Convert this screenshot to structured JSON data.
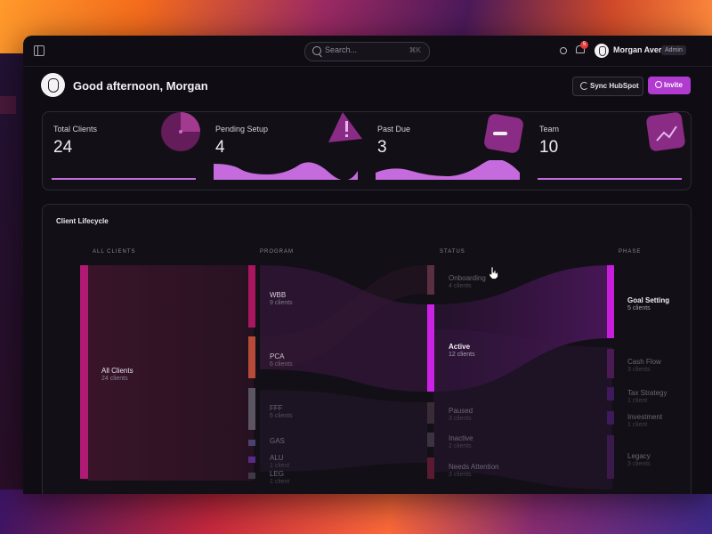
{
  "header": {
    "search_placeholder": "Search...",
    "search_shortcut": "⌘K",
    "notification_count": "5",
    "user_name": "Morgan Avery",
    "user_role": "Admin",
    "icons": [
      "sidebar-toggle-icon",
      "search-icon",
      "sun-icon",
      "bell-icon"
    ]
  },
  "greeting": "Good afternoon, Morgan",
  "actions": {
    "sync_label": "Sync HubSpot",
    "invite_label": "Invite"
  },
  "stats": [
    {
      "label": "Total Clients",
      "value": "24"
    },
    {
      "label": "Pending Setup",
      "value": "4"
    },
    {
      "label": "Past Due",
      "value": "3"
    },
    {
      "label": "Team",
      "value": "10"
    }
  ],
  "lifecycle": {
    "title": "Client Lifecycle",
    "columns": [
      "ALL CLIENTS",
      "PROGRAM",
      "STATUS",
      "PHASE"
    ],
    "nodes": {
      "all": [
        {
          "name": "All Clients",
          "count": "24 clients"
        }
      ],
      "program": [
        {
          "name": "WBB",
          "count": "9 clients"
        },
        {
          "name": "PCA",
          "count": "6 clients"
        },
        {
          "name": "FFF",
          "count": "5 clients"
        },
        {
          "name": "GAS",
          "count": ""
        },
        {
          "name": "ALU",
          "count": "1 client"
        },
        {
          "name": "LEG",
          "count": "1 client"
        }
      ],
      "status": [
        {
          "name": "Onboarding",
          "count": "4 clients"
        },
        {
          "name": "Active",
          "count": "12 clients"
        },
        {
          "name": "Paused",
          "count": "3 clients"
        },
        {
          "name": "Inactive",
          "count": "2 clients"
        },
        {
          "name": "Needs Attention",
          "count": "3 clients"
        }
      ],
      "phase": [
        {
          "name": "Goal Setting",
          "count": "5 clients"
        },
        {
          "name": "Cash Flow",
          "count": "3 clients"
        },
        {
          "name": "Tax Strategy",
          "count": "1 client"
        },
        {
          "name": "Investment",
          "count": "1 client"
        },
        {
          "name": "Legacy",
          "count": "3 clients"
        }
      ]
    }
  },
  "colors": {
    "accent": "#b13ad0",
    "bright": "#d21cf0",
    "magenta": "#c0187a",
    "orange": "#c0462e"
  }
}
